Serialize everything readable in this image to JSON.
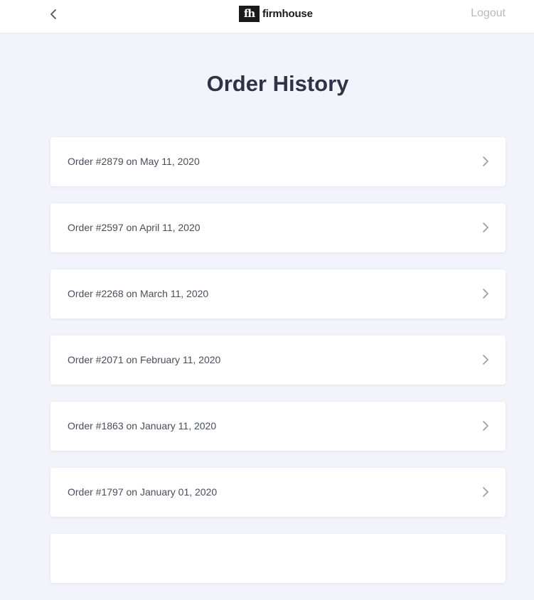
{
  "header": {
    "back_icon": "chevron-left-icon",
    "logo_mark": "fh",
    "logo_text": "firmhouse",
    "logout_label": "Logout"
  },
  "page": {
    "title": "Order History"
  },
  "orders": [
    {
      "label": "Order #2879 on May 11, 2020"
    },
    {
      "label": "Order #2597 on April 11, 2020"
    },
    {
      "label": "Order #2268 on March 11, 2020"
    },
    {
      "label": "Order #2071 on February 11, 2020"
    },
    {
      "label": "Order #1863 on January 11, 2020"
    },
    {
      "label": "Order #1797 on January 01, 2020"
    },
    {
      "label": ""
    }
  ],
  "colors": {
    "background": "#f3f3fb",
    "title": "#2f3346",
    "logout": "#b8b8c0"
  }
}
